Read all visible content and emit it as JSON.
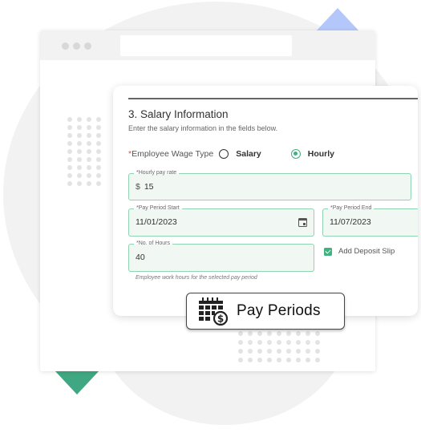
{
  "browser": {
    "window_dots": 3
  },
  "form": {
    "section_title": "3. Salary Information",
    "section_subtitle": "Enter the salary information in the fields below.",
    "wage_type": {
      "required_marker": "*",
      "label": "Employee Wage Type",
      "options": [
        {
          "label": "Salary",
          "selected": false
        },
        {
          "label": "Hourly",
          "selected": true
        }
      ]
    },
    "hourly_pay_rate": {
      "label": "*Hourly pay rate",
      "prefix": "$",
      "value": "15"
    },
    "pay_period_start": {
      "label": "*Pay Period Start",
      "value": "11/01/2023"
    },
    "pay_period_end": {
      "label": "*Pay Period End",
      "value": "11/07/2023"
    },
    "no_of_hours": {
      "label": "*No. of Hours",
      "value": "40",
      "helper": "Employee work hours for the selected pay period"
    },
    "add_deposit_slip": {
      "label": "Add Deposit Slip",
      "checked": true
    }
  },
  "badge": {
    "icon": "calendar-dollar-icon",
    "label": "Pay Periods"
  },
  "colors": {
    "accent_green": "#3fb27f",
    "field_border": "#8fd3b0",
    "field_bg": "#f1f7f3",
    "triangle_blue": "#b3c7fb",
    "triangle_green": "#3fa882",
    "required_red": "#e05050"
  }
}
